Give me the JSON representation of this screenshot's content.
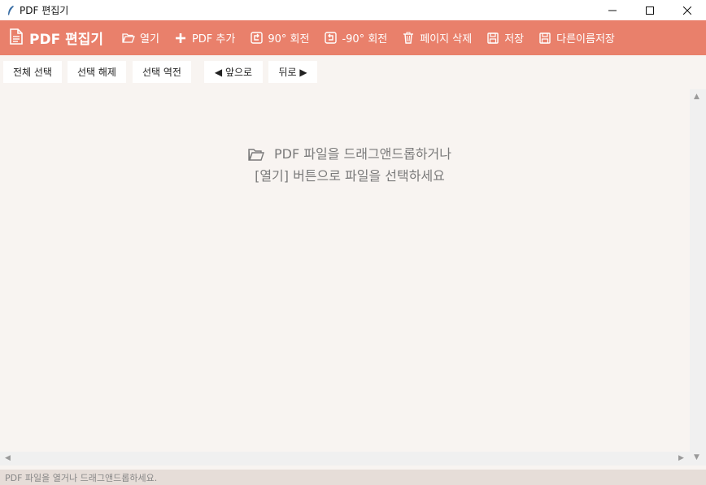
{
  "window": {
    "title": "PDF 편집기",
    "controls": [
      "minimize-icon",
      "maximize-icon",
      "close-icon"
    ]
  },
  "toolbar": {
    "brand": "PDF 편집기",
    "buttons": [
      {
        "label": "열기",
        "icon": "folder-open-icon"
      },
      {
        "label": "PDF 추가",
        "icon": "plus-icon"
      },
      {
        "label": "90° 회전",
        "icon": "rotate-cw-icon"
      },
      {
        "label": "-90° 회전",
        "icon": "rotate-ccw-icon"
      },
      {
        "label": "페이지 삭제",
        "icon": "trash-icon"
      },
      {
        "label": "저장",
        "icon": "save-icon"
      },
      {
        "label": "다른이름저장",
        "icon": "save-as-icon"
      }
    ],
    "colors": {
      "background": "#e9806b",
      "text": "#ffffff"
    }
  },
  "selection": {
    "select_all": "전체 선택",
    "deselect": "선택 해제",
    "invert": "선택 역전",
    "forward": "◀ 앞으로",
    "backward": "뒤로 ▶"
  },
  "canvas": {
    "line1": "PDF 파일을 드래그앤드롭하거나",
    "line2": "[열기] 버튼으로 파일을 선택하세요"
  },
  "status": {
    "text": "PDF 파일을 열거나 드래그앤드롭하세요."
  }
}
